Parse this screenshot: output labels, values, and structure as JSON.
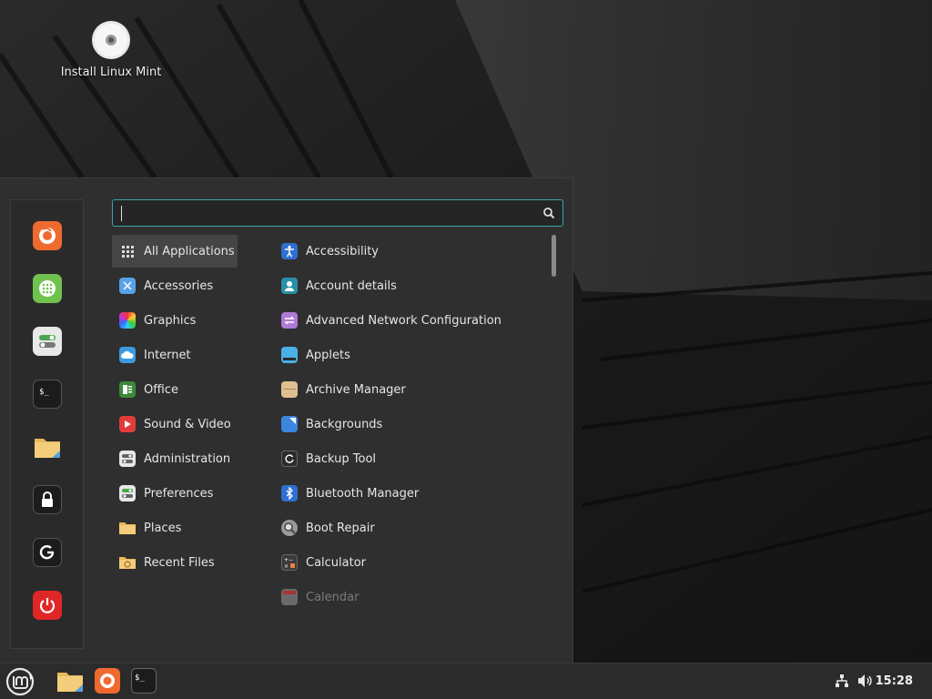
{
  "desktop": {
    "icons": [
      {
        "label": "Install Linux Mint",
        "icon": "disc-icon"
      }
    ]
  },
  "menu": {
    "search": {
      "value": "",
      "placeholder": ""
    },
    "favorites": [
      {
        "name": "firefox",
        "icon": "firefox-icon",
        "color": "#ef6a2f"
      },
      {
        "name": "software-manager",
        "icon": "software-manager-icon",
        "color": "#6fc24e"
      },
      {
        "name": "settings",
        "icon": "toggles-icon",
        "color": "#e8e8e8"
      },
      {
        "name": "terminal",
        "icon": "terminal-icon",
        "color": "#1c1c1c"
      },
      {
        "name": "files",
        "icon": "folder-icon",
        "color": "#f2c46c"
      },
      {
        "name": "lock-screen",
        "icon": "lock-icon",
        "color": "#1c1c1c"
      },
      {
        "name": "logout",
        "icon": "logout-icon",
        "color": "#1c1c1c"
      },
      {
        "name": "shutdown",
        "icon": "power-icon",
        "color": "#e02727"
      }
    ],
    "categories": [
      {
        "label": "All Applications",
        "icon": "grid-icon",
        "color": "#454545"
      },
      {
        "label": "Accessories",
        "icon": "scissors-icon",
        "color": "#5aa2e8"
      },
      {
        "label": "Graphics",
        "icon": "graphics-icon",
        "color": "#c04fc0"
      },
      {
        "label": "Internet",
        "icon": "cloud-icon",
        "color": "#3c9be0"
      },
      {
        "label": "Office",
        "icon": "office-icon",
        "color": "#3b8a3b"
      },
      {
        "label": "Sound & Video",
        "icon": "play-icon",
        "color": "#e23a3a"
      },
      {
        "label": "Administration",
        "icon": "admin-icon",
        "color": "#e8e8e8"
      },
      {
        "label": "Preferences",
        "icon": "prefs-icon",
        "color": "#e8e8e8"
      },
      {
        "label": "Places",
        "icon": "folder-icon",
        "color": "#f2c46c"
      },
      {
        "label": "Recent Files",
        "icon": "recent-folder-icon",
        "color": "#f2c46c"
      }
    ],
    "apps": [
      {
        "label": "Accessibility",
        "icon": "accessibility-icon",
        "color": "#2f6fd1"
      },
      {
        "label": "Account details",
        "icon": "account-icon",
        "color": "#2a8fa8"
      },
      {
        "label": "Advanced Network Configuration",
        "icon": "network-config-icon",
        "color": "#b07ad6"
      },
      {
        "label": "Applets",
        "icon": "applets-icon",
        "color": "#4ab0e8"
      },
      {
        "label": "Archive Manager",
        "icon": "archive-icon",
        "color": "#e0bf94"
      },
      {
        "label": "Backgrounds",
        "icon": "backgrounds-icon",
        "color": "#3d86e0"
      },
      {
        "label": "Backup Tool",
        "icon": "backup-icon",
        "color": "#2b2b2b"
      },
      {
        "label": "Bluetooth Manager",
        "icon": "bluetooth-icon",
        "color": "#2f6fd1"
      },
      {
        "label": "Boot Repair",
        "icon": "boot-repair-icon",
        "color": "#9a9a9a"
      },
      {
        "label": "Calculator",
        "icon": "calculator-icon",
        "color": "#3a3a3a"
      },
      {
        "label": "Calendar",
        "icon": "calendar-icon",
        "color": "#6a6a6a"
      }
    ]
  },
  "panel": {
    "clock": "15:28",
    "launchers": [
      {
        "name": "menu",
        "icon": "mint-logo-icon"
      },
      {
        "name": "files",
        "icon": "folder-icon"
      },
      {
        "name": "firefox",
        "icon": "firefox-icon"
      },
      {
        "name": "terminal",
        "icon": "terminal-icon"
      }
    ],
    "tray": [
      {
        "name": "network",
        "icon": "network-icon"
      },
      {
        "name": "volume",
        "icon": "volume-icon"
      }
    ]
  }
}
